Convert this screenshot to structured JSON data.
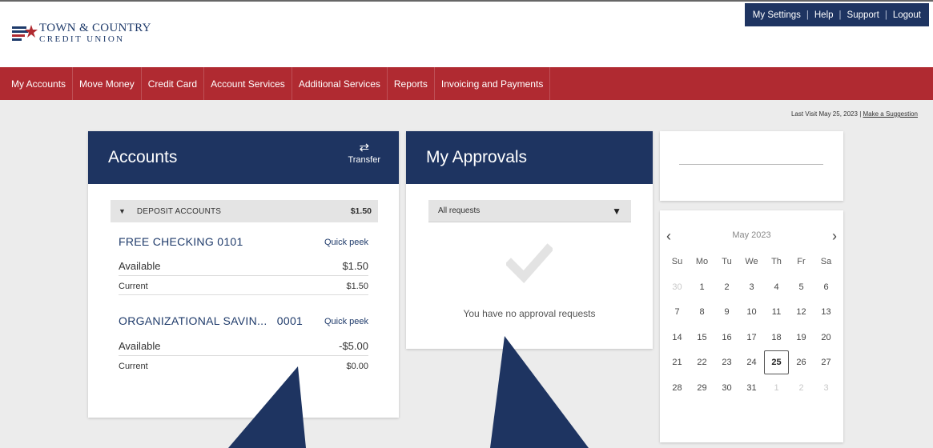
{
  "brand": {
    "line1": "TOWN & COUNTRY",
    "line2": "CREDIT UNION"
  },
  "utility": [
    "My Settings",
    "Help",
    "Support",
    "Logout"
  ],
  "nav": [
    "My Accounts",
    "Move Money",
    "Credit Card",
    "Account Services",
    "Additional Services",
    "Reports",
    "Invoicing and Payments"
  ],
  "last_visit": {
    "text": "Last Visit May 25, 2023",
    "sep": "|",
    "suggestion": "Make a Suggestion"
  },
  "accounts": {
    "title": "Accounts",
    "transfer_label": "Transfer",
    "transfer_icon": "transfer-arrows-icon",
    "group": {
      "label": "DEPOSIT ACCOUNTS",
      "total": "$1.50"
    },
    "items": [
      {
        "name": "FREE CHECKING",
        "number": "0101",
        "quick": "Quick peek",
        "available_label": "Available",
        "available": "$1.50",
        "current_label": "Current",
        "current": "$1.50"
      },
      {
        "name": "ORGANIZATIONAL SAVIN...",
        "number": "0001",
        "quick": "Quick peek",
        "available_label": "Available",
        "available": "-$5.00",
        "current_label": "Current",
        "current": "$0.00"
      }
    ]
  },
  "approvals": {
    "title": "My Approvals",
    "filter": "All requests",
    "empty_text": "You have no approval requests"
  },
  "calendar": {
    "month": "May 2023",
    "days_of_week": [
      "Su",
      "Mo",
      "Tu",
      "We",
      "Th",
      "Fr",
      "Sa"
    ],
    "weeks": [
      [
        "30",
        "1",
        "2",
        "3",
        "4",
        "5",
        "6"
      ],
      [
        "7",
        "8",
        "9",
        "10",
        "11",
        "12",
        "13"
      ],
      [
        "14",
        "15",
        "16",
        "17",
        "18",
        "19",
        "20"
      ],
      [
        "21",
        "22",
        "23",
        "24",
        "25",
        "26",
        "27"
      ],
      [
        "28",
        "29",
        "30",
        "31",
        "1",
        "2",
        "3"
      ]
    ],
    "muted": [
      [
        0,
        0
      ],
      [
        4,
        4
      ],
      [
        4,
        5
      ],
      [
        4,
        6
      ]
    ],
    "today": "25"
  },
  "colors": {
    "navy": "#1e3461",
    "nav_red": "#b02a31",
    "background": "#ececec"
  }
}
